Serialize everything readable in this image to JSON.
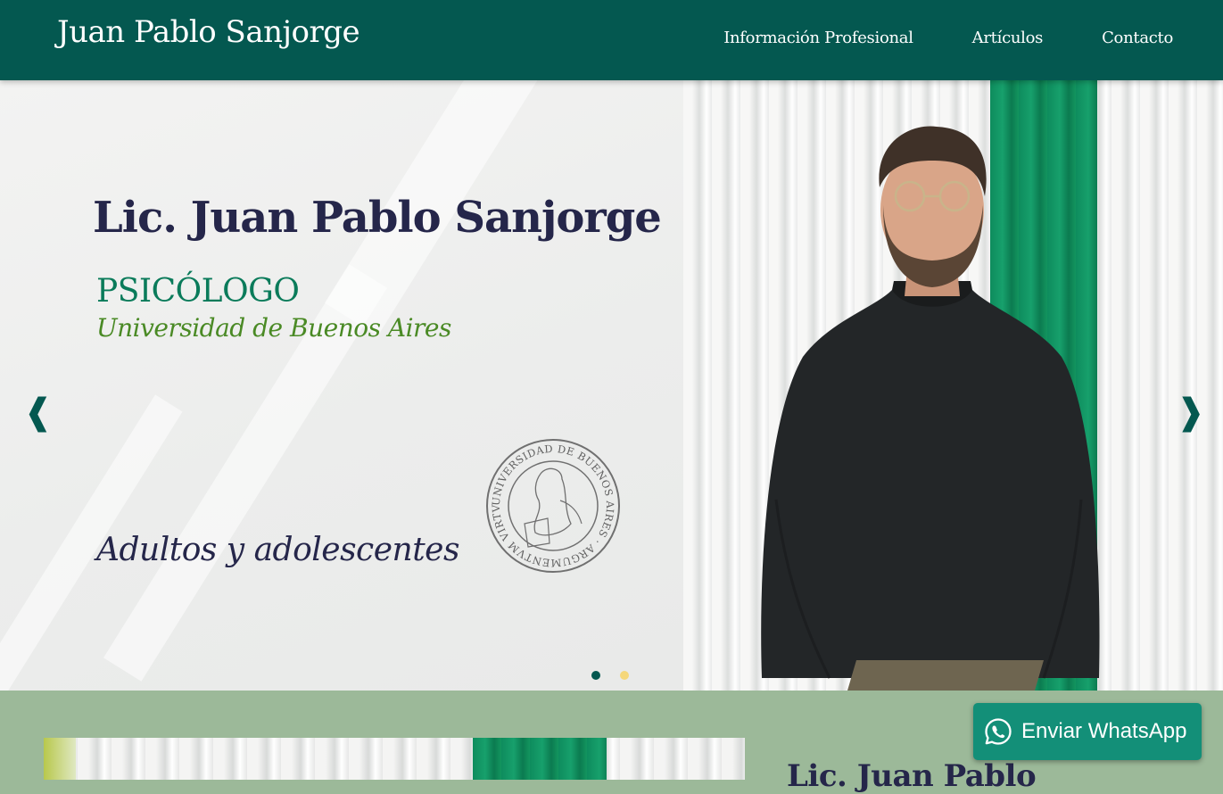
{
  "header": {
    "brand": "Juan Pablo Sanjorge",
    "nav": [
      {
        "label": "Información Profesional"
      },
      {
        "label": "Artículos"
      },
      {
        "label": "Contacto"
      }
    ]
  },
  "hero": {
    "title": "Lic. Juan Pablo Sanjorge",
    "role": "PSICÓLOGO",
    "university": "Universidad de Buenos Aires",
    "audience": "Adultos y adolescentes",
    "seal_text": "UNIVERSIDAD DE BUENOS AIRES · ARGUMENTVM VIRTVS ROBVR",
    "prev_arrow": "❰",
    "next_arrow": "❱",
    "dots": [
      {
        "active": true,
        "color": "#045850"
      },
      {
        "active": false,
        "color": "#f5d77a"
      }
    ]
  },
  "section2": {
    "title": "Lic. Juan Pablo"
  },
  "whatsapp": {
    "label": "Enviar WhatsApp",
    "icon": "whatsapp-icon"
  },
  "colors": {
    "header_bg": "#045850",
    "accent_green": "#0a7b5a",
    "university_green": "#4a8a25",
    "title_navy": "#25264a",
    "section_bg": "#9cb999",
    "whatsapp_bg": "#138f78"
  }
}
